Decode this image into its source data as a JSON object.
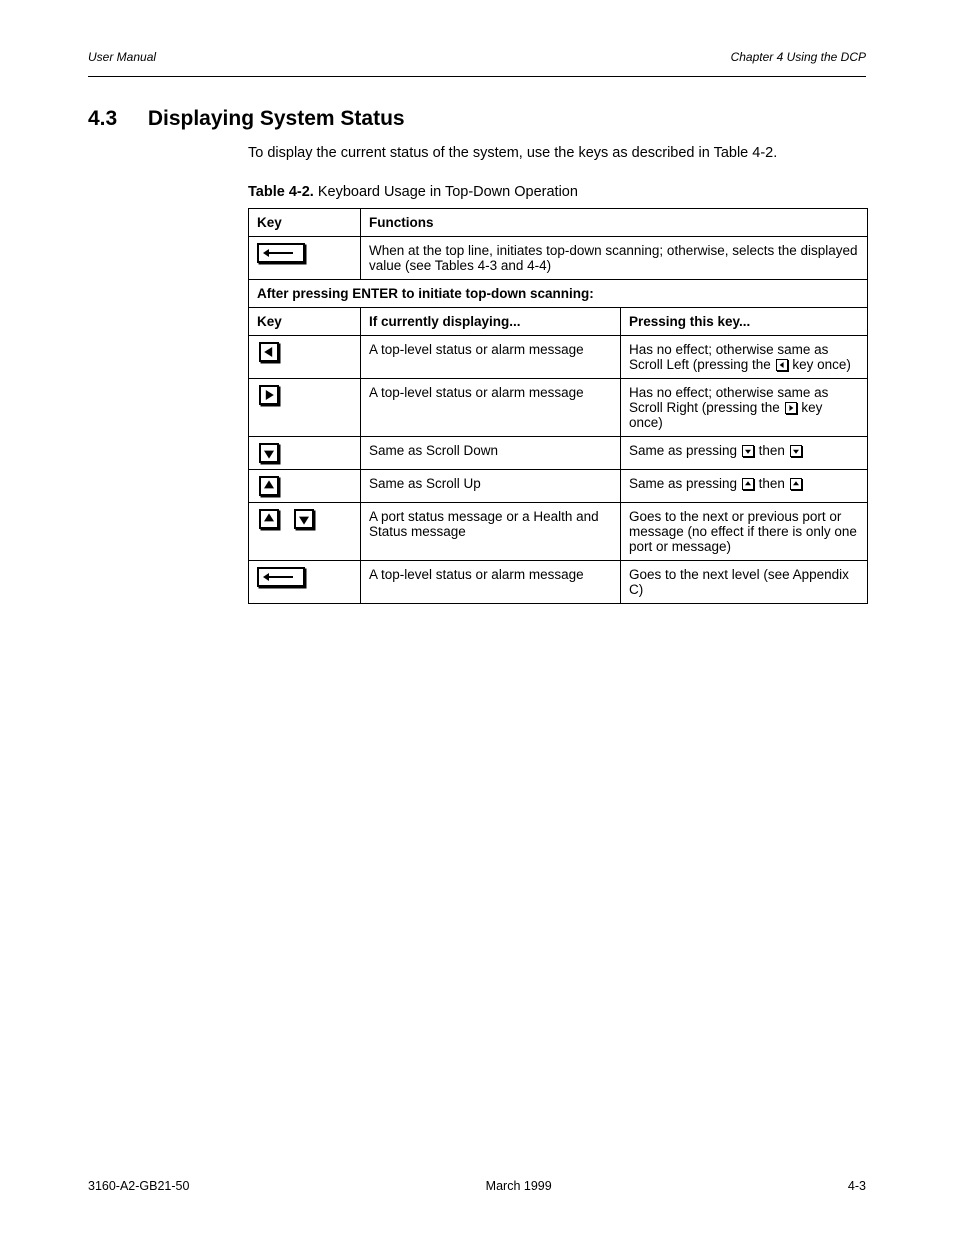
{
  "header": {
    "left": "User Manual",
    "right": "Chapter 4 Using the DCP"
  },
  "section": {
    "number": "4.3",
    "title": "Displaying System Status"
  },
  "intro": "To display the current status of the system, use the keys as described in Table 4-2.",
  "table": {
    "caption_no": "Table 4-2.",
    "caption_text": "Keyboard Usage in Top-Down Operation",
    "col_key": "Key",
    "col_functions": "Functions",
    "row_enter_top": "When at the top line, initiates top-down scanning; otherwise, selects the displayed value (see Tables 4-3 and 4-4)",
    "section_header": "After pressing ENTER to initiate top-down scanning:",
    "col_if_displaying": "If currently displaying...",
    "col_pressing": "Pressing this key...",
    "rows": [
      {
        "if": "A top-level status or alarm message",
        "press_prefix": "Has no effect; otherwise same as Scroll Left (pressing the ",
        "press_suffix": " key once)"
      },
      {
        "if": "A top-level status or alarm message",
        "press_prefix": "Has no effect; otherwise same as Scroll Right (pressing the ",
        "press_suffix": " key once)"
      },
      {
        "if": "Same as Scroll Down",
        "press_prefix": "Same as pressing ",
        "press_mid": " then ",
        "press_suffix": ""
      },
      {
        "if": "Same as Scroll Up",
        "press_prefix": "Same as pressing ",
        "press_mid": " then ",
        "press_suffix": ""
      },
      {
        "if": "A port status message or a Health and Status message",
        "press": "Goes to the next or previous port or message (no effect if there is only one port or message)"
      },
      {
        "if": "A top-level status or alarm message",
        "press": "Goes to the next level (see Appendix C)"
      }
    ]
  },
  "footer": {
    "left": "3160-A2-GB21-50",
    "center": "March 1999",
    "right": "4-3"
  }
}
